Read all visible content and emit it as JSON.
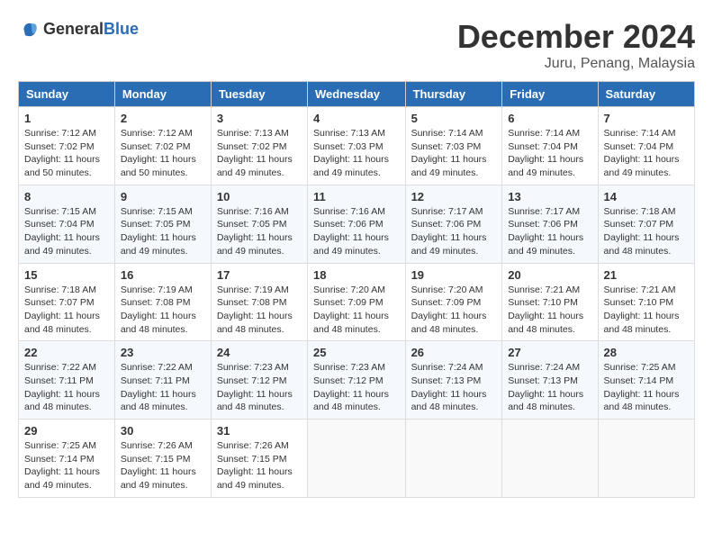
{
  "header": {
    "logo_general": "General",
    "logo_blue": "Blue",
    "month_title": "December 2024",
    "location": "Juru, Penang, Malaysia"
  },
  "days_of_week": [
    "Sunday",
    "Monday",
    "Tuesday",
    "Wednesday",
    "Thursday",
    "Friday",
    "Saturday"
  ],
  "weeks": [
    [
      {
        "day": "1",
        "sunrise": "7:12 AM",
        "sunset": "7:02 PM",
        "daylight": "11 hours and 50 minutes."
      },
      {
        "day": "2",
        "sunrise": "7:12 AM",
        "sunset": "7:02 PM",
        "daylight": "11 hours and 50 minutes."
      },
      {
        "day": "3",
        "sunrise": "7:13 AM",
        "sunset": "7:02 PM",
        "daylight": "11 hours and 49 minutes."
      },
      {
        "day": "4",
        "sunrise": "7:13 AM",
        "sunset": "7:03 PM",
        "daylight": "11 hours and 49 minutes."
      },
      {
        "day": "5",
        "sunrise": "7:14 AM",
        "sunset": "7:03 PM",
        "daylight": "11 hours and 49 minutes."
      },
      {
        "day": "6",
        "sunrise": "7:14 AM",
        "sunset": "7:04 PM",
        "daylight": "11 hours and 49 minutes."
      },
      {
        "day": "7",
        "sunrise": "7:14 AM",
        "sunset": "7:04 PM",
        "daylight": "11 hours and 49 minutes."
      }
    ],
    [
      {
        "day": "8",
        "sunrise": "7:15 AM",
        "sunset": "7:04 PM",
        "daylight": "11 hours and 49 minutes."
      },
      {
        "day": "9",
        "sunrise": "7:15 AM",
        "sunset": "7:05 PM",
        "daylight": "11 hours and 49 minutes."
      },
      {
        "day": "10",
        "sunrise": "7:16 AM",
        "sunset": "7:05 PM",
        "daylight": "11 hours and 49 minutes."
      },
      {
        "day": "11",
        "sunrise": "7:16 AM",
        "sunset": "7:06 PM",
        "daylight": "11 hours and 49 minutes."
      },
      {
        "day": "12",
        "sunrise": "7:17 AM",
        "sunset": "7:06 PM",
        "daylight": "11 hours and 49 minutes."
      },
      {
        "day": "13",
        "sunrise": "7:17 AM",
        "sunset": "7:06 PM",
        "daylight": "11 hours and 49 minutes."
      },
      {
        "day": "14",
        "sunrise": "7:18 AM",
        "sunset": "7:07 PM",
        "daylight": "11 hours and 48 minutes."
      }
    ],
    [
      {
        "day": "15",
        "sunrise": "7:18 AM",
        "sunset": "7:07 PM",
        "daylight": "11 hours and 48 minutes."
      },
      {
        "day": "16",
        "sunrise": "7:19 AM",
        "sunset": "7:08 PM",
        "daylight": "11 hours and 48 minutes."
      },
      {
        "day": "17",
        "sunrise": "7:19 AM",
        "sunset": "7:08 PM",
        "daylight": "11 hours and 48 minutes."
      },
      {
        "day": "18",
        "sunrise": "7:20 AM",
        "sunset": "7:09 PM",
        "daylight": "11 hours and 48 minutes."
      },
      {
        "day": "19",
        "sunrise": "7:20 AM",
        "sunset": "7:09 PM",
        "daylight": "11 hours and 48 minutes."
      },
      {
        "day": "20",
        "sunrise": "7:21 AM",
        "sunset": "7:10 PM",
        "daylight": "11 hours and 48 minutes."
      },
      {
        "day": "21",
        "sunrise": "7:21 AM",
        "sunset": "7:10 PM",
        "daylight": "11 hours and 48 minutes."
      }
    ],
    [
      {
        "day": "22",
        "sunrise": "7:22 AM",
        "sunset": "7:11 PM",
        "daylight": "11 hours and 48 minutes."
      },
      {
        "day": "23",
        "sunrise": "7:22 AM",
        "sunset": "7:11 PM",
        "daylight": "11 hours and 48 minutes."
      },
      {
        "day": "24",
        "sunrise": "7:23 AM",
        "sunset": "7:12 PM",
        "daylight": "11 hours and 48 minutes."
      },
      {
        "day": "25",
        "sunrise": "7:23 AM",
        "sunset": "7:12 PM",
        "daylight": "11 hours and 48 minutes."
      },
      {
        "day": "26",
        "sunrise": "7:24 AM",
        "sunset": "7:13 PM",
        "daylight": "11 hours and 48 minutes."
      },
      {
        "day": "27",
        "sunrise": "7:24 AM",
        "sunset": "7:13 PM",
        "daylight": "11 hours and 48 minutes."
      },
      {
        "day": "28",
        "sunrise": "7:25 AM",
        "sunset": "7:14 PM",
        "daylight": "11 hours and 48 minutes."
      }
    ],
    [
      {
        "day": "29",
        "sunrise": "7:25 AM",
        "sunset": "7:14 PM",
        "daylight": "11 hours and 49 minutes."
      },
      {
        "day": "30",
        "sunrise": "7:26 AM",
        "sunset": "7:15 PM",
        "daylight": "11 hours and 49 minutes."
      },
      {
        "day": "31",
        "sunrise": "7:26 AM",
        "sunset": "7:15 PM",
        "daylight": "11 hours and 49 minutes."
      },
      null,
      null,
      null,
      null
    ]
  ],
  "labels": {
    "sunrise": "Sunrise:",
    "sunset": "Sunset:",
    "daylight": "Daylight:"
  }
}
